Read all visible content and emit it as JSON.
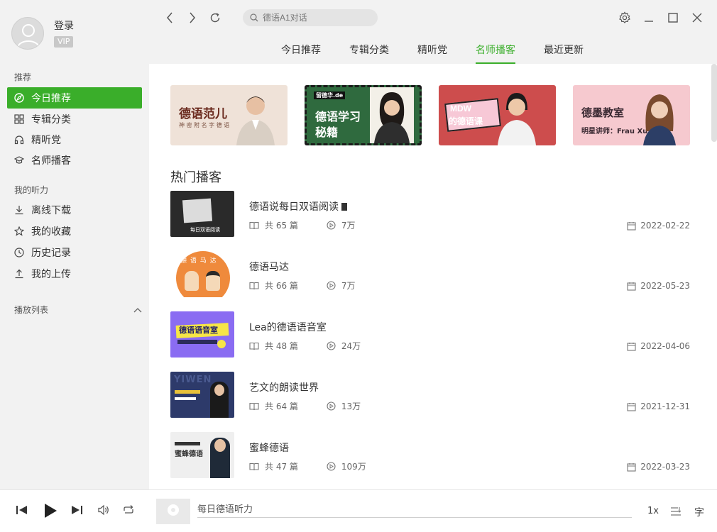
{
  "user": {
    "login_label": "登录",
    "vip_label": "VIP"
  },
  "sidebar": {
    "section_recommend": "推荐",
    "recommend_items": [
      {
        "label": "今日推荐",
        "icon": "compass-icon",
        "active": true
      },
      {
        "label": "专辑分类",
        "icon": "grid-icon",
        "active": false
      },
      {
        "label": "精听党",
        "icon": "headphones-icon",
        "active": false
      },
      {
        "label": "名师播客",
        "icon": "graduation-cap-icon",
        "active": false
      }
    ],
    "section_mine": "我的听力",
    "mine_items": [
      {
        "label": "离线下载",
        "icon": "download-icon"
      },
      {
        "label": "我的收藏",
        "icon": "star-icon"
      },
      {
        "label": "历史记录",
        "icon": "clock-icon"
      },
      {
        "label": "我的上传",
        "icon": "upload-icon"
      }
    ],
    "playlist_label": "播放列表"
  },
  "search": {
    "placeholder": "德语A1对话"
  },
  "tabs": [
    {
      "label": "今日推荐",
      "active": false
    },
    {
      "label": "专辑分类",
      "active": false
    },
    {
      "label": "精听党",
      "active": false
    },
    {
      "label": "名师播客",
      "active": true
    },
    {
      "label": "最近更新",
      "active": false
    }
  ],
  "banners": [
    {
      "title": "德语范儿",
      "subtitle": "神 密 附 名 字 德 语"
    },
    {
      "tag": "留德华.de",
      "title": "德语学习",
      "title2": "秘籍"
    },
    {
      "title": "MDW",
      "title2": "的德语课"
    },
    {
      "title": "德墨教室",
      "subtitle": "明星讲师：Frau Xu"
    }
  ],
  "hot_title": "热门播客",
  "podcasts": [
    {
      "title": "德语说每日双语阅读",
      "episodes": "共 65 篇",
      "plays": "7万",
      "date": "2022-02-22",
      "thumb_text": "每日双语阅读"
    },
    {
      "title": "德语马达",
      "episodes": "共 66 篇",
      "plays": "7万",
      "date": "2022-05-23",
      "thumb_text": "德 语 马 达"
    },
    {
      "title": "Lea的德语语音室",
      "episodes": "共 48 篇",
      "plays": "24万",
      "date": "2022-04-06",
      "thumb_text": "德语语音室"
    },
    {
      "title": "艺文的朗读世界",
      "episodes": "共 64 篇",
      "plays": "13万",
      "date": "2021-12-31",
      "thumb_text": "YIWEN"
    },
    {
      "title": "蜜蜂德语",
      "episodes": "共 47 篇",
      "plays": "109万",
      "date": "2022-03-23",
      "thumb_text": "蜜蜂德语"
    }
  ],
  "player": {
    "track": "每日德语听力",
    "speed": "1x",
    "lyrics": "字"
  },
  "colors": {
    "accent": "#3aae2a",
    "sidebar_bg": "#f2f2f2"
  }
}
